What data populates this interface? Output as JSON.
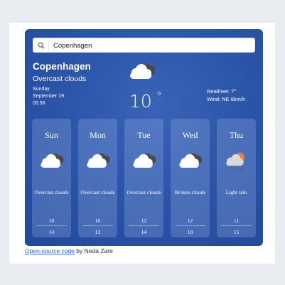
{
  "search": {
    "value": "Copenhagen",
    "icon": "search-icon"
  },
  "current": {
    "city": "Copenhagen",
    "condition": "Overcast clouds",
    "weekday": "Sunday",
    "date": "September 19",
    "time": "05:56",
    "temperature": "10",
    "degree": "°",
    "realfeel": "RealFeel: 7°",
    "wind": "Wind: NE 6km/h",
    "icon": "overcast-clouds-icon"
  },
  "forecast": [
    {
      "day": "Sun",
      "description": "Overcast clouds",
      "low": "10",
      "high": "14",
      "icon": "overcast-clouds-icon"
    },
    {
      "day": "Mon",
      "description": "Overcast clouds",
      "low": "10",
      "high": "13",
      "icon": "overcast-clouds-icon"
    },
    {
      "day": "Tue",
      "description": "Overcast clouds",
      "low": "12",
      "high": "14",
      "icon": "overcast-clouds-icon"
    },
    {
      "day": "Wed",
      "description": "Broken clouds",
      "low": "12",
      "high": "18",
      "icon": "broken-clouds-icon"
    },
    {
      "day": "Thu",
      "description": "Light rain",
      "low": "11",
      "high": "15",
      "icon": "light-rain-icon"
    }
  ],
  "footer": {
    "link": "Open-source code",
    "author": " by Neda Zare"
  },
  "colors": {
    "card": "#2c56aa",
    "link": "#2b5fd6",
    "page": "#e9ecf1"
  }
}
